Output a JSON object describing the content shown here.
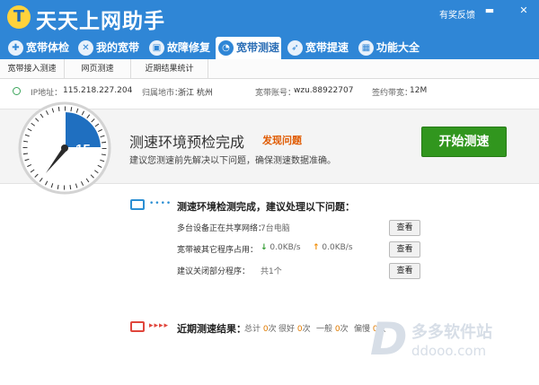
{
  "app": {
    "title": "天天上网助手",
    "feedback": "有奖反馈",
    "minimize": "▬",
    "close": "✕"
  },
  "nav": {
    "tabs": [
      {
        "label": "宽带体检",
        "icon": "shield-icon"
      },
      {
        "label": "我的宽带",
        "icon": "globe-icon"
      },
      {
        "label": "故障修复",
        "icon": "toolbox-icon"
      },
      {
        "label": "宽带测速",
        "icon": "speedometer-icon"
      },
      {
        "label": "宽带提速",
        "icon": "rocket-icon"
      },
      {
        "label": "功能大全",
        "icon": "grid-icon"
      }
    ]
  },
  "subtabs": [
    "宽带接入测速",
    "网页测速",
    "近期结果统计"
  ],
  "info": {
    "ip_label": "IP地址：",
    "ip": "115.218.227.204",
    "region_label": "归属地市：",
    "region": "浙江 杭州",
    "account_label": "宽带账号：",
    "account": "wzu.88922707",
    "bandwidth_label": "签约带宽：",
    "bandwidth": "12M"
  },
  "hero": {
    "dial_value": "15",
    "title": "测速环境预检完成",
    "issue": "发现问题",
    "subtitle": "建议您测速前先解决以下问题，确保测速数据准确。",
    "start": "开始测速"
  },
  "check": {
    "title": "测速环境检测完成，建议处理以下问题：",
    "dots": "••••",
    "rows": [
      {
        "label": "多台设备正在共享网络：",
        "value": "7台电脑",
        "action": "查看"
      },
      {
        "label": "宽带被其它程序占用：",
        "down": "0.0KB/s",
        "up": "0.0KB/s",
        "action": "查看"
      },
      {
        "label": "建议关闭部分程序：",
        "value": "共1个",
        "action": "查看"
      }
    ]
  },
  "recent": {
    "title": "近期测速结果：",
    "dots": "▸▸▸▸",
    "total_label": "总计",
    "total": "0",
    "total_unit": "次",
    "good_label": "很好",
    "good": "0",
    "good_unit": "次",
    "fair_label": "一般",
    "fair": "0",
    "fair_unit": "次",
    "low_label": "偏慢",
    "low": "0",
    "low_unit": "次"
  },
  "watermark": {
    "title": "多多软件站",
    "url": "ddooo.com",
    "mark": "D"
  },
  "colors": {
    "brand": "#2f86d6",
    "start": "#31961e",
    "issue": "#e05a00"
  }
}
